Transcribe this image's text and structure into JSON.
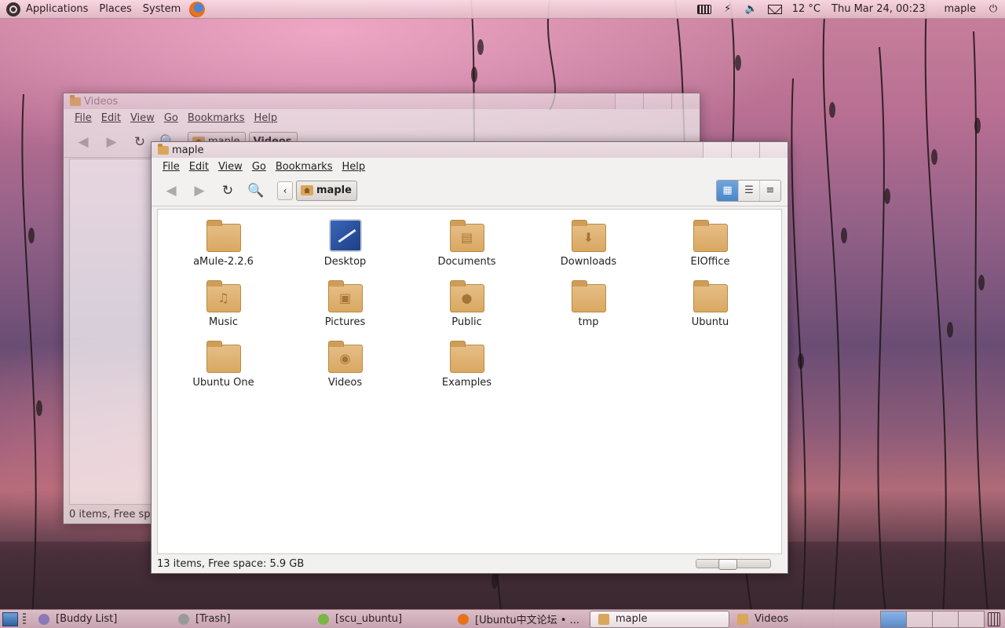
{
  "top_panel": {
    "menus": [
      "Applications",
      "Places",
      "System"
    ],
    "temperature": "12 °C",
    "datetime": "Thu Mar 24, 00:23",
    "user": "maple"
  },
  "back_window": {
    "title": "Videos",
    "menus": [
      "File",
      "Edit",
      "View",
      "Go",
      "Bookmarks",
      "Help"
    ],
    "crumbs": [
      "maple",
      "Videos"
    ],
    "status": "0 items, Free space"
  },
  "front_window": {
    "title": "maple",
    "menus": [
      "File",
      "Edit",
      "View",
      "Go",
      "Bookmarks",
      "Help"
    ],
    "location": "maple",
    "items": [
      {
        "label": "aMule-2.2.6",
        "icon": "folder-icon"
      },
      {
        "label": "Desktop",
        "icon": "desktop-icon"
      },
      {
        "label": "Documents",
        "icon": "documents-folder-icon"
      },
      {
        "label": "Downloads",
        "icon": "downloads-folder-icon"
      },
      {
        "label": "EIOffice",
        "icon": "folder-icon"
      },
      {
        "label": "Music",
        "icon": "music-folder-icon"
      },
      {
        "label": "Pictures",
        "icon": "pictures-folder-icon"
      },
      {
        "label": "Public",
        "icon": "public-folder-icon"
      },
      {
        "label": "tmp",
        "icon": "folder-icon"
      },
      {
        "label": "Ubuntu",
        "icon": "folder-icon"
      },
      {
        "label": "Ubuntu One",
        "icon": "folder-icon"
      },
      {
        "label": "Videos",
        "icon": "videos-folder-icon"
      },
      {
        "label": "Examples",
        "icon": "folder-icon"
      }
    ],
    "status": "13 items, Free space: 5.9 GB",
    "zoom_level": 0.4
  },
  "taskbar": {
    "tasks": [
      {
        "label": "[Buddy List]",
        "icon": "pidgin-icon",
        "color": "#8a78b8"
      },
      {
        "label": "[Trash]",
        "icon": "trash-icon",
        "color": "#9a9a9a"
      },
      {
        "label": "[scu_ubuntu]",
        "icon": "status-icon",
        "color": "#7ab648"
      },
      {
        "label": "[Ubuntu中文论坛 • ...",
        "icon": "firefox-icon",
        "color": "#e8721a"
      },
      {
        "label": "maple",
        "icon": "folder-icon",
        "color": "#d9a65b",
        "active": true
      },
      {
        "label": "Videos",
        "icon": "folder-icon",
        "color": "#d9a65b"
      }
    ]
  }
}
